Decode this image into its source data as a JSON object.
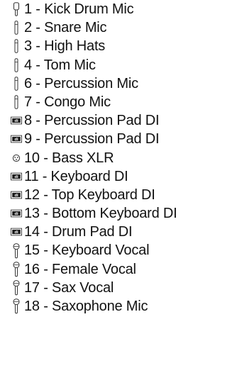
{
  "channels": [
    {
      "label": "1 - Kick Drum Mic",
      "icon": "dynamic-mic-icon"
    },
    {
      "label": "2 - Snare Mic",
      "icon": "pencil-mic-icon"
    },
    {
      "label": "3 - High Hats",
      "icon": "pencil-mic-icon"
    },
    {
      "label": "4 - Tom Mic",
      "icon": "pencil-mic-icon"
    },
    {
      "label": "6 - Percussion Mic",
      "icon": "pencil-mic-icon"
    },
    {
      "label": "7 - Congo Mic",
      "icon": "pencil-mic-icon"
    },
    {
      "label": "8 - Percussion Pad DI",
      "icon": "di-box-icon"
    },
    {
      "label": "9 - Percussion Pad DI",
      "icon": "di-box-icon"
    },
    {
      "label": "10 - Bass XLR",
      "icon": "xlr-connector-icon"
    },
    {
      "label": "11 - Keyboard DI",
      "icon": "di-box-icon"
    },
    {
      "label": "12 - Top Keyboard DI",
      "icon": "di-box-icon"
    },
    {
      "label": "13 - Bottom Keyboard DI",
      "icon": "di-box-icon"
    },
    {
      "label": "14 - Drum Pad DI",
      "icon": "di-box-icon"
    },
    {
      "label": "15 - Keyboard Vocal",
      "icon": "vocal-mic-icon"
    },
    {
      "label": "16 - Female Vocal",
      "icon": "vocal-mic-icon"
    },
    {
      "label": "17 - Sax Vocal",
      "icon": "vocal-mic-icon"
    },
    {
      "label": "18 - Saxophone Mic",
      "icon": "vocal-mic-icon"
    }
  ],
  "di_badge_text": "di"
}
